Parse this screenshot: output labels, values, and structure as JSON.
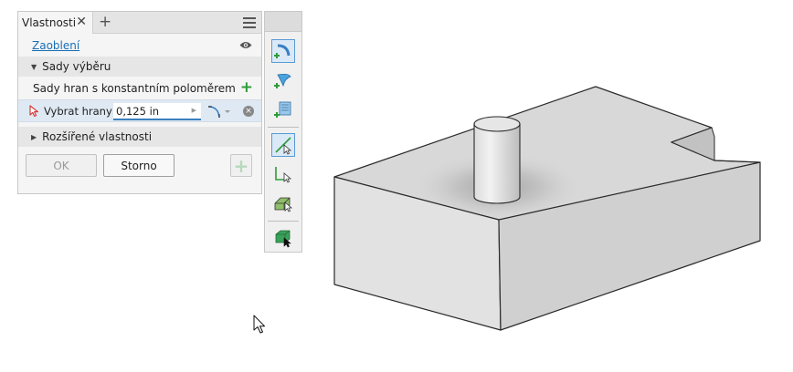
{
  "panel": {
    "tab_title": "Vlastnosti",
    "close_glyph": "✕",
    "add_tab_glyph": "+",
    "feature_name": "Zaoblení",
    "section_selection": "Sady výběru",
    "edge_sets_label": "Sady hran s konstantním poloměrem",
    "add_set_glyph": "+",
    "select_edges_label": "Vybrat hrany",
    "radius_value": "0,125 in",
    "clear_glyph": "×",
    "section_advanced": "Rozšířené vlastnosti",
    "ok_label": "OK",
    "cancel_label": "Storno",
    "apply_glyph": "+"
  },
  "toolbar": {
    "tools": [
      {
        "icon": "fillet-edge-icon",
        "active": true
      },
      {
        "icon": "fillet-face-icon",
        "active": false
      },
      {
        "icon": "fillet-full-round-icon",
        "active": false
      },
      {
        "icon": "select-edge-icon",
        "active": true
      },
      {
        "icon": "select-loop-icon",
        "active": false
      },
      {
        "icon": "select-feature-icon",
        "active": false
      },
      {
        "icon": "select-solid-icon",
        "active": false
      }
    ]
  },
  "colors": {
    "accent": "#3a7fc1",
    "link": "#1a6fb5",
    "add_green": "#2e9c3a",
    "selection_bg": "#dfe9f3",
    "model_top": "#d8d8d8",
    "model_front": "#e2e2e2",
    "model_side": "#c9c9c9"
  }
}
